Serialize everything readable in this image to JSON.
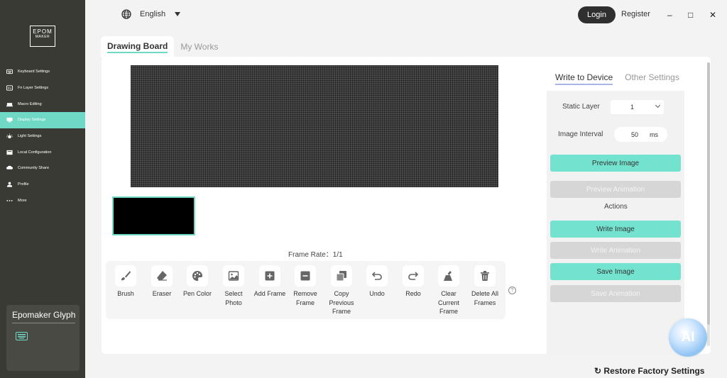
{
  "app": {
    "logo_text_line1": "EPOM",
    "logo_text_line2": "MAKER"
  },
  "sidebar": {
    "items": [
      {
        "label": "Keyboard Settings",
        "icon": "keyboard-icon"
      },
      {
        "label": "Fn Layer Settings",
        "icon": "fn-layer-icon"
      },
      {
        "label": "Macro Editing",
        "icon": "macro-icon"
      },
      {
        "label": "Display Settings",
        "icon": "display-icon",
        "active": true
      },
      {
        "label": "Light Settings",
        "icon": "light-icon"
      },
      {
        "label": "Local Configuration",
        "icon": "local-config-icon"
      },
      {
        "label": "Community Share",
        "icon": "community-icon"
      },
      {
        "label": "Profile",
        "icon": "profile-icon"
      },
      {
        "label": "More",
        "icon": "more-icon"
      }
    ],
    "device": {
      "name": "Epomaker Glyph",
      "icon": "keyboard-icon"
    }
  },
  "topbar": {
    "language": "English",
    "login": "Login",
    "register": "Register",
    "minimize": "–",
    "maximize": "□",
    "close": "✕"
  },
  "tabs": {
    "drawing_board": "Drawing Board",
    "my_works": "My Works"
  },
  "frame_rate": "Frame Rate：1/1",
  "tools": [
    {
      "label": "Brush",
      "icon": "brush-icon"
    },
    {
      "label": "Eraser",
      "icon": "eraser-icon"
    },
    {
      "label": "Pen Color",
      "icon": "palette-icon"
    },
    {
      "label": "Select Photo",
      "icon": "image-icon"
    },
    {
      "label": "Add Frame",
      "icon": "add-icon"
    },
    {
      "label": "Remove Frame",
      "icon": "remove-icon"
    },
    {
      "label": "Copy Previous Frame",
      "icon": "copy-icon"
    },
    {
      "label": "Undo",
      "icon": "undo-icon"
    },
    {
      "label": "Redo",
      "icon": "redo-icon"
    },
    {
      "label": "Clear Current Frame",
      "icon": "clear-icon"
    },
    {
      "label": "Delete All Frames",
      "icon": "trash-icon"
    }
  ],
  "help": "?",
  "right_panel": {
    "tab_write": "Write to Device",
    "tab_other": "Other Settings",
    "static_layer_label": "Static Layer",
    "static_layer_value": "1",
    "image_interval_label": "Image Interval",
    "image_interval_value": "50",
    "image_interval_unit": "ms",
    "preview_image": "Preview Image",
    "preview_animation": "Preview Animation",
    "actions_label": "Actions",
    "write_image": "Write Image",
    "write_animation": "Write Animation",
    "save_image": "Save Image",
    "save_animation": "Save Animation"
  },
  "ai_badge": "AI",
  "restore": "Restore Factory Settings",
  "colors": {
    "accent": "#6fd9c6",
    "sidebar_bg": "#3a3a34",
    "button_on": "#73e3cf",
    "button_off": "#d6d6d6"
  }
}
